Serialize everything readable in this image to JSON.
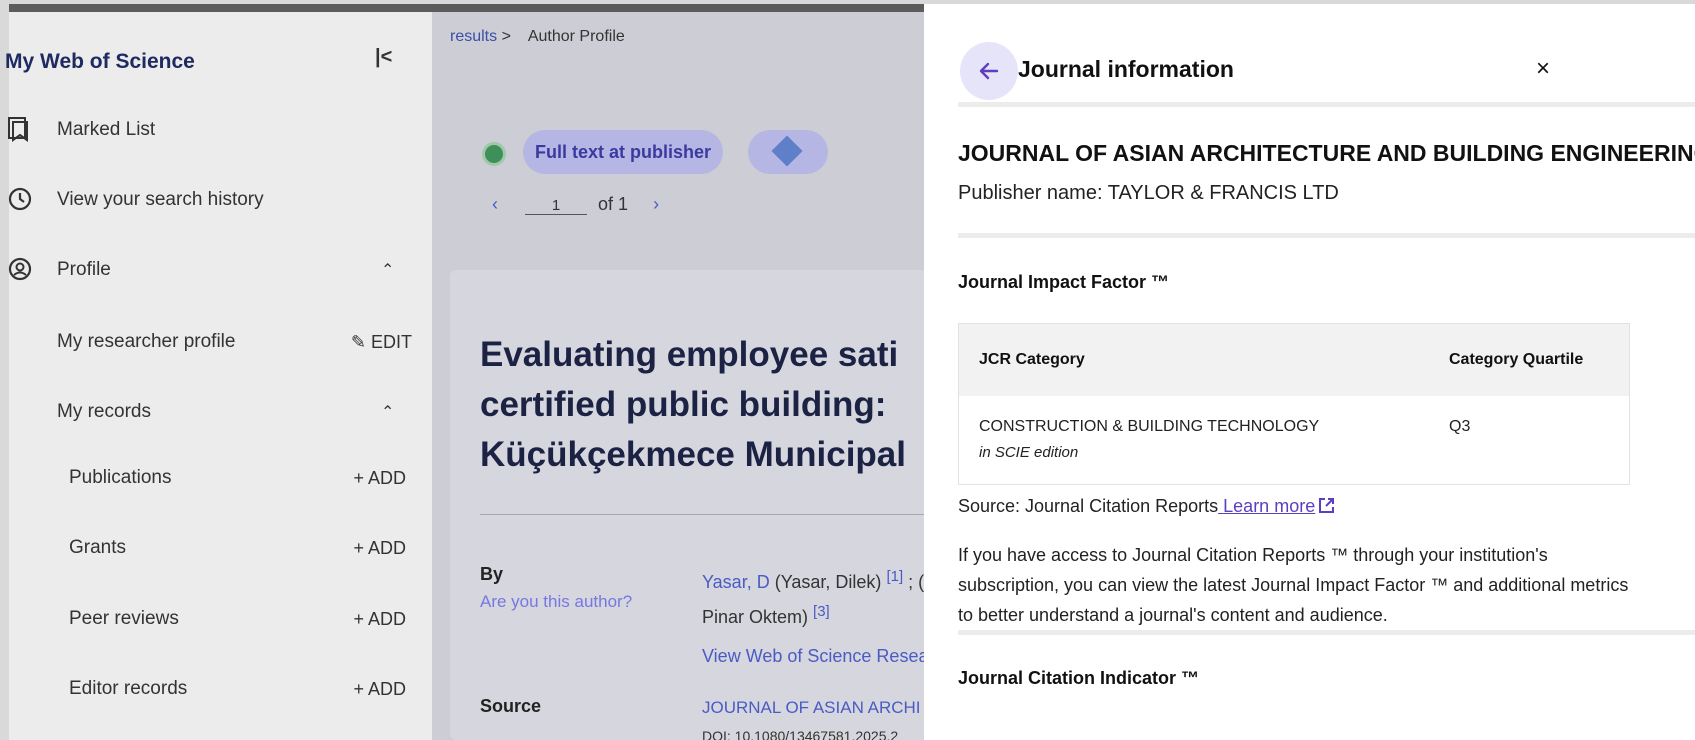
{
  "sidebar": {
    "title": "My Web of Science",
    "collapse_icon": "|<",
    "items": [
      {
        "label": "Marked List"
      },
      {
        "label": "View your search history"
      },
      {
        "label": "Profile"
      },
      {
        "label": "My researcher profile",
        "action": "EDIT"
      },
      {
        "label": "My records"
      },
      {
        "label": "Publications",
        "action": "+ ADD"
      },
      {
        "label": "Grants",
        "action": "+ ADD"
      },
      {
        "label": "Peer reviews",
        "action": "+ ADD"
      },
      {
        "label": "Editor records",
        "action": "+ ADD"
      }
    ]
  },
  "main": {
    "breadcrumb": {
      "link": "results",
      "separator": ">",
      "current": "Author Profile"
    },
    "full_text_label": "Full text at publisher",
    "pager": {
      "page": "1",
      "of_label": "of 1"
    },
    "article_title_lines": [
      "Evaluating employee sati",
      "certified public building:",
      "Küçükçekmece Municipal"
    ],
    "by_label": "By",
    "author_question": "Are you this author?",
    "authors": {
      "first_link": "Yasar, D",
      "first_name": "(Yasar, Dilek)",
      "first_ref": "[1]",
      "sep": "; (",
      "second_name": "Pinar Oktem)",
      "second_ref": "[3]"
    },
    "view_link": "View Web of Science Resea",
    "source_label": "Source",
    "source_value": "JOURNAL OF ASIAN ARCHI",
    "doi": "DOI: 10.1080/13467581.2025.2"
  },
  "panel": {
    "title": "Journal information",
    "close_label": "×",
    "journal_name": "JOURNAL OF ASIAN ARCHITECTURE AND BUILDING ENGINEERING",
    "publisher": "Publisher name: TAYLOR & FRANCIS LTD",
    "jif_title": "Journal Impact Factor ™",
    "table": {
      "headers": [
        "JCR Category",
        "Category Quartile"
      ],
      "rows": [
        {
          "category": "CONSTRUCTION & BUILDING TECHNOLOGY",
          "edition": "in SCIE edition",
          "quartile": "Q3"
        }
      ]
    },
    "source_text": "Source: Journal Citation Reports",
    "learn_more": "Learn more",
    "description": "If you have access to Journal Citation Reports ™ through your institution's subscription, you can view the latest Journal Impact Factor ™ and additional metrics to better understand a journal's content and audience.",
    "jci_title": "Journal Citation Indicator ™"
  },
  "colors": {
    "accent": "#5b3fc0",
    "back_button_bg": "#e6e4f8",
    "link_blue": "#4a5bc4",
    "overlay_dim": "#d9d9d9"
  },
  "icons": {
    "back": "arrow-left-icon",
    "close": "close-icon",
    "external": "external-link-icon",
    "marked_list": "bookmark-icon",
    "history": "history-icon",
    "profile": "user-circle-icon",
    "edit": "pencil-icon"
  }
}
